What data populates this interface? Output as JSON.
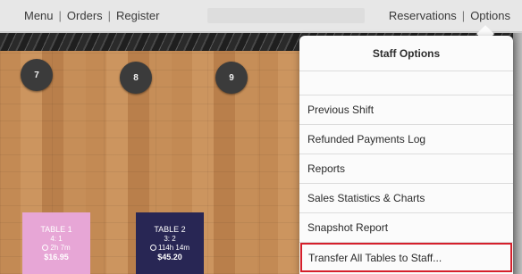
{
  "topbar": {
    "nav_left": [
      "Menu",
      "Orders",
      "Register"
    ],
    "separator": "|",
    "nav_right": [
      "Reservations",
      "Options"
    ]
  },
  "seats": [
    "7",
    "8",
    "9"
  ],
  "tables": [
    {
      "name": "TABLE 1",
      "covers": "4: 1",
      "time": "2h 7m",
      "amount": "$16.95",
      "color": "#e7a6d6"
    },
    {
      "name": "TABLE 2",
      "covers": "3: 2",
      "time": "114h 14m",
      "amount": "$45.20",
      "color": "#282654"
    }
  ],
  "dropdown": {
    "title": "Staff Options",
    "items": [
      "Previous Shift",
      "Refunded Payments Log",
      "Reports",
      "Sales Statistics & Charts",
      "Snapshot Report",
      "Transfer All Tables to Staff..."
    ],
    "highlight_color": "#d51f2b"
  }
}
